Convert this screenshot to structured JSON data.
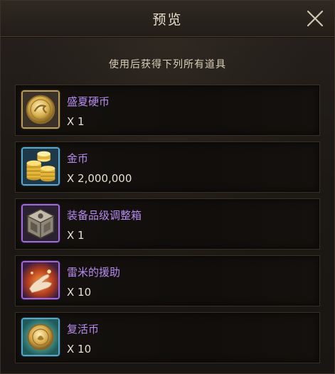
{
  "header": {
    "title": "预览",
    "close_icon": "close-icon"
  },
  "subtitle": "使用后获得下列所有道具",
  "items": [
    {
      "name": "盛夏硬币",
      "quantity": "X 1",
      "icon": "summer-coin-icon",
      "frame_color": "#b99a5e",
      "name_color": "#b78bef"
    },
    {
      "name": "金币",
      "quantity": "X 2,000,000",
      "icon": "gold-coins-icon",
      "frame_color": "#5ba6c9",
      "name_color": "#b78bef"
    },
    {
      "name": "装备品级调整箱",
      "quantity": "X 1",
      "icon": "equipment-box-icon",
      "frame_color": "#9f6bd6",
      "name_color": "#b78bef"
    },
    {
      "name": "雷米的援助",
      "quantity": "X 10",
      "icon": "helping-hand-icon",
      "frame_color": "#9f6bd6",
      "name_color": "#b78bef"
    },
    {
      "name": "复活币",
      "quantity": "X 10",
      "icon": "revive-coin-icon",
      "frame_color": "#5ba6c9",
      "name_color": "#b78bef"
    }
  ]
}
